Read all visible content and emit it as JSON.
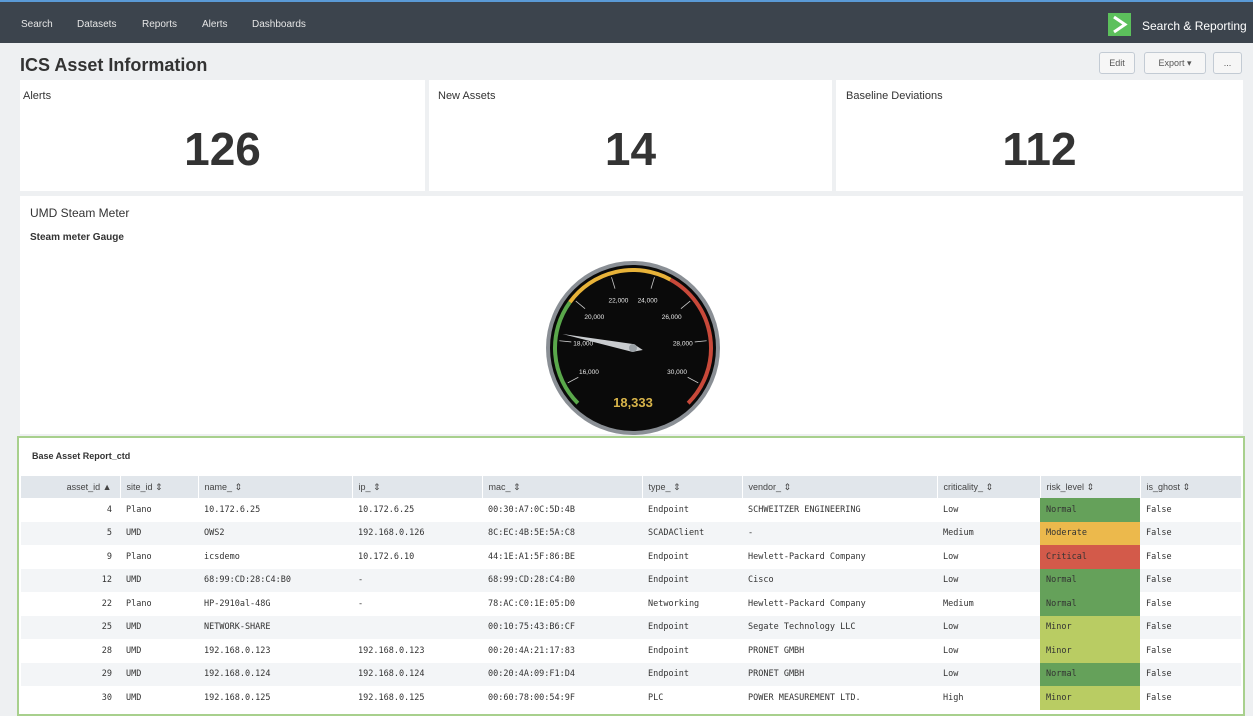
{
  "nav": {
    "items": [
      "Search",
      "Datasets",
      "Reports",
      "Alerts",
      "Dashboards"
    ],
    "app_title": "Search & Reporting"
  },
  "page": {
    "title": "ICS Asset Information",
    "edit_label": "Edit",
    "export_label": "Export ▾",
    "more_label": "..."
  },
  "singles": [
    {
      "label": "Alerts",
      "value": "126"
    },
    {
      "label": "New Assets",
      "value": "14"
    },
    {
      "label": "Baseline Deviations",
      "value": "112"
    }
  ],
  "steam": {
    "panel_title": "UMD Steam Meter",
    "subtitle": "Steam meter Gauge",
    "gauge": {
      "value": 18333,
      "value_label": "18,333",
      "min": 15000,
      "max": 31000,
      "ticks": [
        "16,000",
        "18,000",
        "20,000",
        "22,000",
        "24,000",
        "26,000",
        "28,000",
        "30,000"
      ],
      "colors": {
        "green": "#5aa84b",
        "yellow": "#e8b339",
        "red": "#c8493a"
      }
    }
  },
  "table": {
    "title": "Base Asset Report_ctd",
    "columns": [
      "asset_id ▲",
      "site_id ⇕",
      "name_ ⇕",
      "ip_ ⇕",
      "mac_ ⇕",
      "type_ ⇕",
      "vendor_ ⇕",
      "criticality_ ⇕",
      "risk_level ⇕",
      "is_ghost ⇕"
    ],
    "rows": [
      [
        "4",
        "Plano",
        "10.172.6.25",
        "10.172.6.25",
        "00:30:A7:0C:5D:4B",
        "Endpoint",
        "SCHWEITZER ENGINEERING",
        "Low",
        "Normal",
        "False"
      ],
      [
        "5",
        "UMD",
        "OWS2",
        "192.168.0.126",
        "8C:EC:4B:5E:5A:C8",
        "SCADAClient",
        "-",
        "Medium",
        "Moderate",
        "False"
      ],
      [
        "9",
        "Plano",
        "icsdemo",
        "10.172.6.10",
        "44:1E:A1:5F:86:BE",
        "Endpoint",
        "Hewlett-Packard Company",
        "Low",
        "Critical",
        "False"
      ],
      [
        "12",
        "UMD",
        "68:99:CD:28:C4:B0",
        "-",
        "68:99:CD:28:C4:B0",
        "Endpoint",
        "Cisco",
        "Low",
        "Normal",
        "False"
      ],
      [
        "22",
        "Plano",
        "HP-2910al-48G",
        "-",
        "78:AC:C0:1E:05:D0",
        "Networking",
        "Hewlett-Packard Company",
        "Medium",
        "Normal",
        "False"
      ],
      [
        "25",
        "UMD",
        "NETWORK-SHARE",
        "",
        "00:10:75:43:B6:CF",
        "Endpoint",
        "Segate Technology LLC",
        "Low",
        "Minor",
        "False"
      ],
      [
        "28",
        "UMD",
        "192.168.0.123",
        "192.168.0.123",
        "00:20:4A:21:17:83",
        "Endpoint",
        "PRONET GMBH",
        "Low",
        "Minor",
        "False"
      ],
      [
        "29",
        "UMD",
        "192.168.0.124",
        "192.168.0.124",
        "00:20:4A:09:F1:D4",
        "Endpoint",
        "PRONET GMBH",
        "Low",
        "Normal",
        "False"
      ],
      [
        "30",
        "UMD",
        "192.168.0.125",
        "192.168.0.125",
        "00:60:78:00:54:9F",
        "PLC",
        "POWER MEASUREMENT LTD.",
        "High",
        "Minor",
        "False"
      ]
    ],
    "risk_colors": {
      "Normal": "#65a15a",
      "Moderate": "#ecb94c",
      "Critical": "#d35a4a",
      "Minor": "#b9cc63"
    }
  }
}
